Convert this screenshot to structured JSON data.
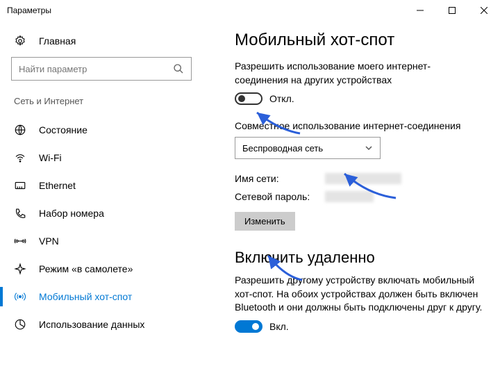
{
  "window": {
    "title": "Параметры"
  },
  "sidebar": {
    "home": "Главная",
    "search_placeholder": "Найти параметр",
    "category": "Сеть и Интернет",
    "items": [
      {
        "label": "Состояние"
      },
      {
        "label": "Wi-Fi"
      },
      {
        "label": "Ethernet"
      },
      {
        "label": "Набор номера"
      },
      {
        "label": "VPN"
      },
      {
        "label": "Режим «в самолете»"
      },
      {
        "label": "Мобильный хот-спот"
      },
      {
        "label": "Использование данных"
      }
    ]
  },
  "main": {
    "title": "Мобильный хот-спот",
    "share_desc": "Разрешить использование моего интернет-соединения на других устройствах",
    "toggle_off": "Откл.",
    "share_from_label": "Совместное использование интернет-соединения",
    "dropdown_value": "Беспроводная сеть",
    "network_name_label": "Имя сети:",
    "network_pass_label": "Сетевой пароль:",
    "edit_button": "Изменить",
    "remote_title": "Включить удаленно",
    "remote_desc": "Разрешить другому устройству включать мобильный хот-спот. На обоих устройствах должен быть включен Bluetooth и они должны быть подключены друг к другу.",
    "toggle_on": "Вкл."
  }
}
